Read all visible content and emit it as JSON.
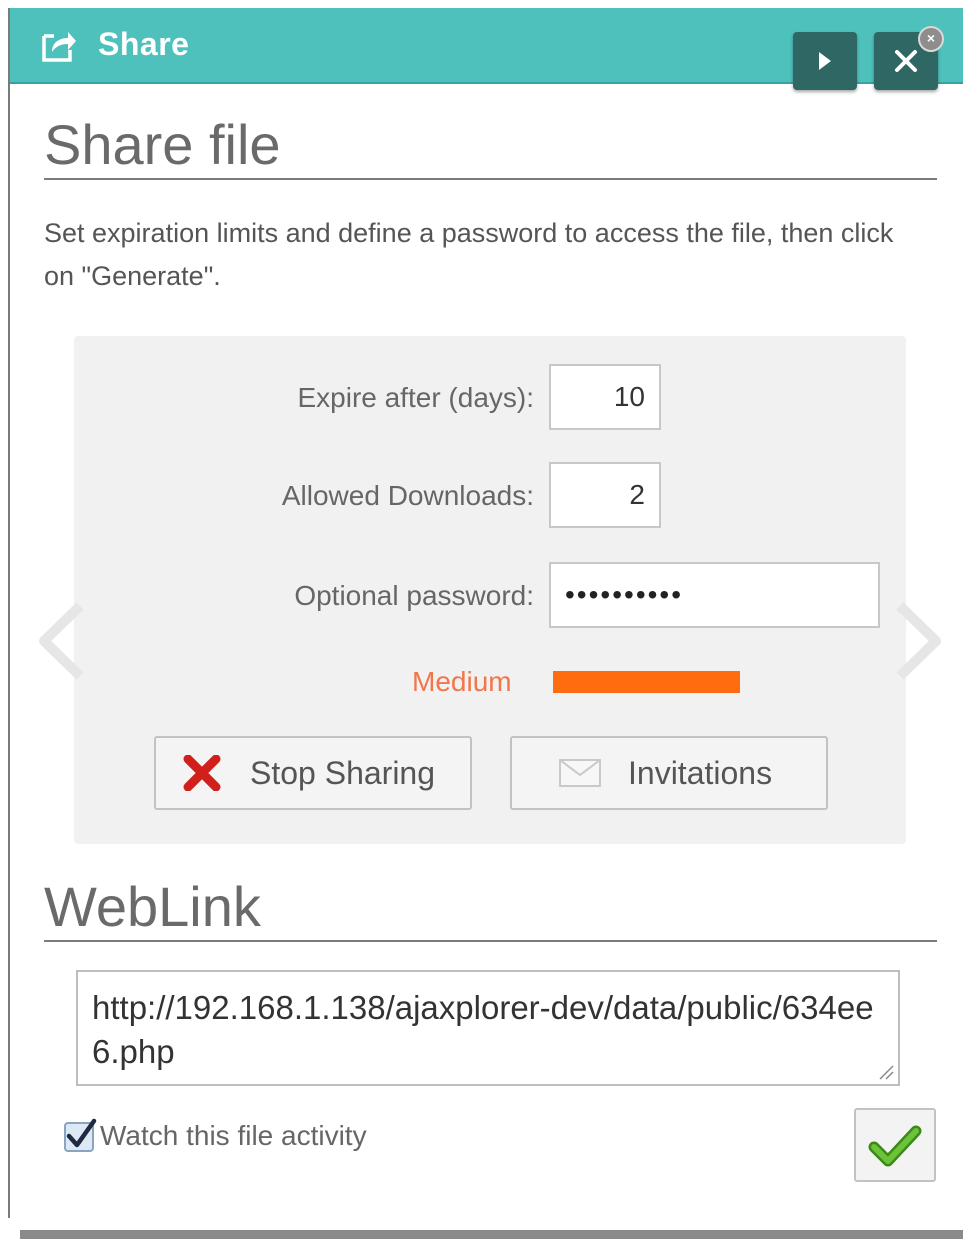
{
  "window": {
    "title": "Share",
    "play_icon": "play-icon",
    "close_icon": "close-icon"
  },
  "share_section": {
    "heading": "Share file",
    "description": "Set expiration limits and define a password to access the file, then click on \"Generate\"."
  },
  "form": {
    "expire_label": "Expire after (days):",
    "expire_value": "10",
    "downloads_label": "Allowed Downloads:",
    "downloads_value": "2",
    "password_label": "Optional password:",
    "password_value": "••••••••••",
    "strength_label": "Medium",
    "strength_color": "#ff6c10"
  },
  "buttons": {
    "stop_sharing": "Stop Sharing",
    "invitations": "Invitations"
  },
  "weblink_section": {
    "heading": "WebLink",
    "url": "http://192.168.1.138/ajaxplorer-dev/data/public/634ee6.php"
  },
  "watch": {
    "label": "Watch this file activity",
    "checked": true
  },
  "colors": {
    "titlebar": "#4fc1bc",
    "accent_green": "#4aa31c",
    "stop_red": "#d1201c"
  }
}
